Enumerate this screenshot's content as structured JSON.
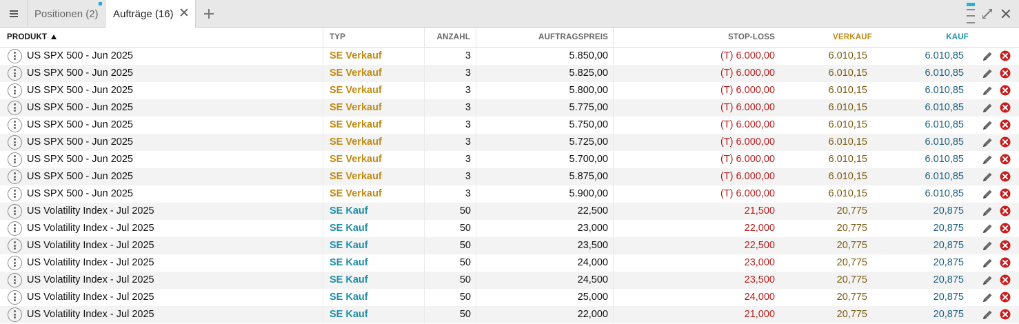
{
  "tabs": {
    "positions_label": "Positionen (2)",
    "orders_label": "Aufträge (16)"
  },
  "columns": {
    "produkt": "PRODUKT",
    "typ": "TYP",
    "anzahl": "ANZAHL",
    "auftragspreis": "AUFTRAGSPREIS",
    "stop_loss": "STOP-LOSS",
    "verkauf": "VERKAUF",
    "kauf": "KAUF"
  },
  "colors": {
    "sell": "#c08a14",
    "buy": "#1e8fa8",
    "stop_loss": "#b61c1c",
    "delete": "#c81e1e"
  },
  "orders": [
    {
      "produkt": "US SPX 500 - Jun 2025",
      "typ": "SE Verkauf",
      "side": "sell",
      "anzahl": "3",
      "auftragspreis": "5.850,00",
      "stop_loss": "(T) 6.000,00",
      "verkauf": "6.010,15",
      "kauf": "6.010,85"
    },
    {
      "produkt": "US SPX 500 - Jun 2025",
      "typ": "SE Verkauf",
      "side": "sell",
      "anzahl": "3",
      "auftragspreis": "5.825,00",
      "stop_loss": "(T) 6.000,00",
      "verkauf": "6.010,15",
      "kauf": "6.010,85"
    },
    {
      "produkt": "US SPX 500 - Jun 2025",
      "typ": "SE Verkauf",
      "side": "sell",
      "anzahl": "3",
      "auftragspreis": "5.800,00",
      "stop_loss": "(T) 6.000,00",
      "verkauf": "6.010,15",
      "kauf": "6.010,85"
    },
    {
      "produkt": "US SPX 500 - Jun 2025",
      "typ": "SE Verkauf",
      "side": "sell",
      "anzahl": "3",
      "auftragspreis": "5.775,00",
      "stop_loss": "(T) 6.000,00",
      "verkauf": "6.010,15",
      "kauf": "6.010,85"
    },
    {
      "produkt": "US SPX 500 - Jun 2025",
      "typ": "SE Verkauf",
      "side": "sell",
      "anzahl": "3",
      "auftragspreis": "5.750,00",
      "stop_loss": "(T) 6.000,00",
      "verkauf": "6.010,15",
      "kauf": "6.010,85"
    },
    {
      "produkt": "US SPX 500 - Jun 2025",
      "typ": "SE Verkauf",
      "side": "sell",
      "anzahl": "3",
      "auftragspreis": "5.725,00",
      "stop_loss": "(T) 6.000,00",
      "verkauf": "6.010,15",
      "kauf": "6.010,85"
    },
    {
      "produkt": "US SPX 500 - Jun 2025",
      "typ": "SE Verkauf",
      "side": "sell",
      "anzahl": "3",
      "auftragspreis": "5.700,00",
      "stop_loss": "(T) 6.000,00",
      "verkauf": "6.010,15",
      "kauf": "6.010,85"
    },
    {
      "produkt": "US SPX 500 - Jun 2025",
      "typ": "SE Verkauf",
      "side": "sell",
      "anzahl": "3",
      "auftragspreis": "5.875,00",
      "stop_loss": "(T) 6.000,00",
      "verkauf": "6.010,15",
      "kauf": "6.010,85"
    },
    {
      "produkt": "US SPX 500 - Jun 2025",
      "typ": "SE Verkauf",
      "side": "sell",
      "anzahl": "3",
      "auftragspreis": "5.900,00",
      "stop_loss": "(T) 6.000,00",
      "verkauf": "6.010,15",
      "kauf": "6.010,85"
    },
    {
      "produkt": "US Volatility Index - Jul 2025",
      "typ": "SE Kauf",
      "side": "buy",
      "anzahl": "50",
      "auftragspreis": "22,500",
      "stop_loss": "21,500",
      "verkauf": "20,775",
      "kauf": "20,875"
    },
    {
      "produkt": "US Volatility Index - Jul 2025",
      "typ": "SE Kauf",
      "side": "buy",
      "anzahl": "50",
      "auftragspreis": "23,000",
      "stop_loss": "22,000",
      "verkauf": "20,775",
      "kauf": "20,875"
    },
    {
      "produkt": "US Volatility Index - Jul 2025",
      "typ": "SE Kauf",
      "side": "buy",
      "anzahl": "50",
      "auftragspreis": "23,500",
      "stop_loss": "22,500",
      "verkauf": "20,775",
      "kauf": "20,875"
    },
    {
      "produkt": "US Volatility Index - Jul 2025",
      "typ": "SE Kauf",
      "side": "buy",
      "anzahl": "50",
      "auftragspreis": "24,000",
      "stop_loss": "23,000",
      "verkauf": "20,775",
      "kauf": "20,875"
    },
    {
      "produkt": "US Volatility Index - Jul 2025",
      "typ": "SE Kauf",
      "side": "buy",
      "anzahl": "50",
      "auftragspreis": "24,500",
      "stop_loss": "23,500",
      "verkauf": "20,775",
      "kauf": "20,875"
    },
    {
      "produkt": "US Volatility Index - Jul 2025",
      "typ": "SE Kauf",
      "side": "buy",
      "anzahl": "50",
      "auftragspreis": "25,000",
      "stop_loss": "24,000",
      "verkauf": "20,775",
      "kauf": "20,875"
    },
    {
      "produkt": "US Volatility Index - Jul 2025",
      "typ": "SE Kauf",
      "side": "buy",
      "anzahl": "50",
      "auftragspreis": "22,000",
      "stop_loss": "21,000",
      "verkauf": "20,775",
      "kauf": "20,875"
    }
  ]
}
